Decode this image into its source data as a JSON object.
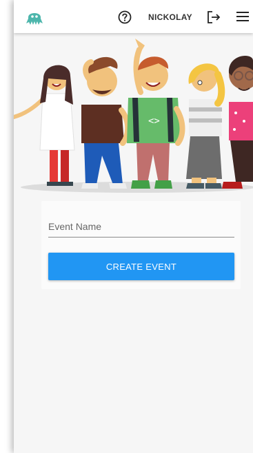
{
  "header": {
    "logo": "octopus-logo",
    "help_icon": "question-circle-icon",
    "username": "NICKOLAY",
    "logout_icon": "logout-arrow-icon",
    "menu_icon": "hamburger-menu-icon"
  },
  "hero": {
    "illustration": "group-of-people-waving"
  },
  "form": {
    "event_name_placeholder": "Event Name",
    "event_name_value": "",
    "create_label": "CREATE EVENT"
  },
  "colors": {
    "accent": "#2196f3",
    "logo": "#4db6ac"
  }
}
